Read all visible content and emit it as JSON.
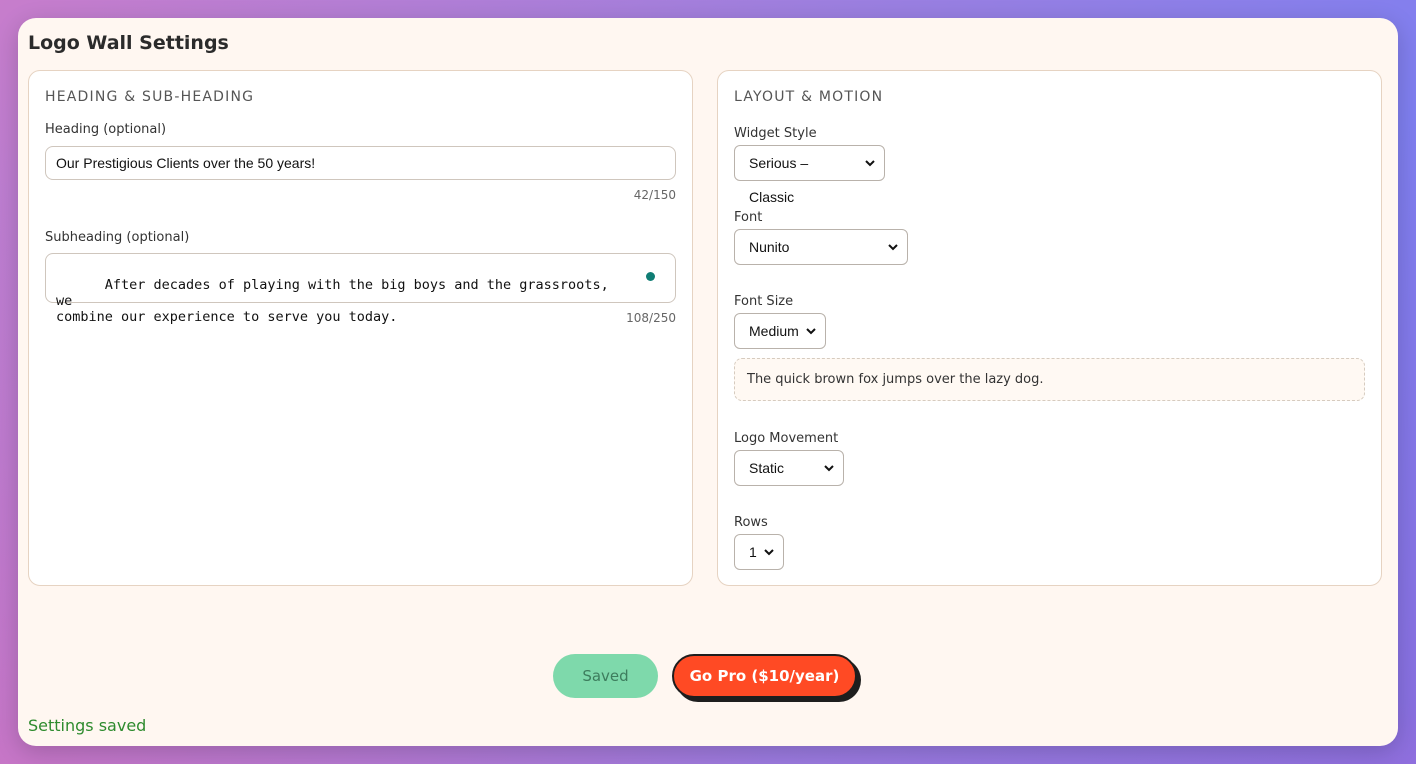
{
  "page": {
    "title": "Logo Wall Settings"
  },
  "heading_card": {
    "title": "Heading & Sub-Heading",
    "heading_label": "Heading (optional)",
    "heading_value": "Our Prestigious Clients over the 50 years!",
    "heading_counter": "42/150",
    "subheading_label": "Subheading (optional)",
    "subheading_value": "After decades of playing with the big boys and the grassroots, we\ncombine our experience to serve you today.",
    "subheading_counter": "108/250"
  },
  "layout_card": {
    "title": "Layout & Motion",
    "widget_style_label": "Widget Style",
    "widget_style_value": "Serious – Classic",
    "font_label": "Font",
    "font_value": "Nunito",
    "font_size_label": "Font Size",
    "font_size_value": "Medium",
    "preview_text": "The quick brown fox jumps over the lazy dog.",
    "logo_movement_label": "Logo Movement",
    "logo_movement_value": "Static",
    "rows_label": "Rows",
    "rows_value": "1"
  },
  "actions": {
    "saved_label": "Saved",
    "pro_label": "Go Pro ($10/year)"
  },
  "status": {
    "message": "Settings saved"
  },
  "colors": {
    "accent": "#ff4a24",
    "saved_green": "#7ed9ab",
    "status_green": "#2e8b2e",
    "indicator_teal": "#0f7d74"
  }
}
